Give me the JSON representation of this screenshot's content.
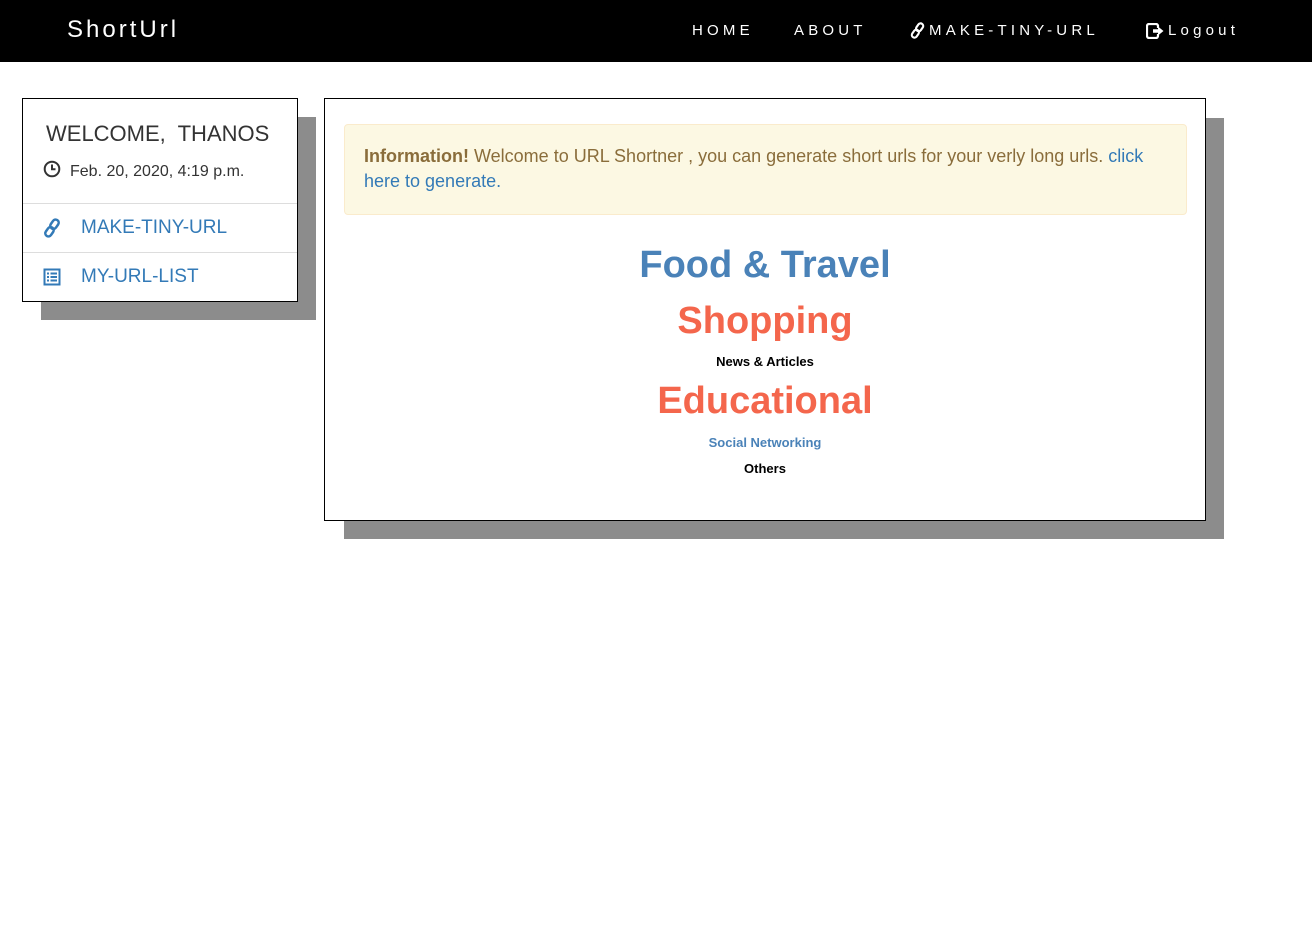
{
  "nav": {
    "brand": "ShortUrl",
    "home": "HOME",
    "about": "ABOUT",
    "make_tiny_url": "MAKE-TINY-URL",
    "logout": "Logout",
    "make_icon": "link-icon",
    "logout_icon": "logout-icon"
  },
  "sidebar": {
    "welcome": "WELCOME,  THANOS",
    "date": "Feb. 20, 2020, 4:19 p.m.",
    "date_icon": "clock-icon",
    "items": [
      {
        "label": "MAKE-TINY-URL",
        "icon": "link-icon"
      },
      {
        "label": "MY-URL-LIST",
        "icon": "list-icon"
      }
    ]
  },
  "alert": {
    "strong": "Information!",
    "message": " Welcome to URL Shortner , you can generate short urls for your verly long urls. ",
    "link": "click here to generate."
  },
  "categories": [
    {
      "label": "Food & Travel",
      "color": "#4a82b8"
    },
    {
      "label": "Shopping",
      "color": "#f4664c"
    },
    {
      "label": "News & Articles",
      "color": "#000000"
    },
    {
      "label": "Educational",
      "color": "#f4664c"
    },
    {
      "label": "Social Networking",
      "color": "#4a82b8"
    },
    {
      "label": "Others",
      "color": "#000000"
    }
  ],
  "colors": {
    "navbar_bg": "#000000",
    "link": "#337ab7",
    "alert_bg": "#fcf8e3",
    "alert_text": "#8a6d3b",
    "shadow": "#8c8c8c"
  }
}
